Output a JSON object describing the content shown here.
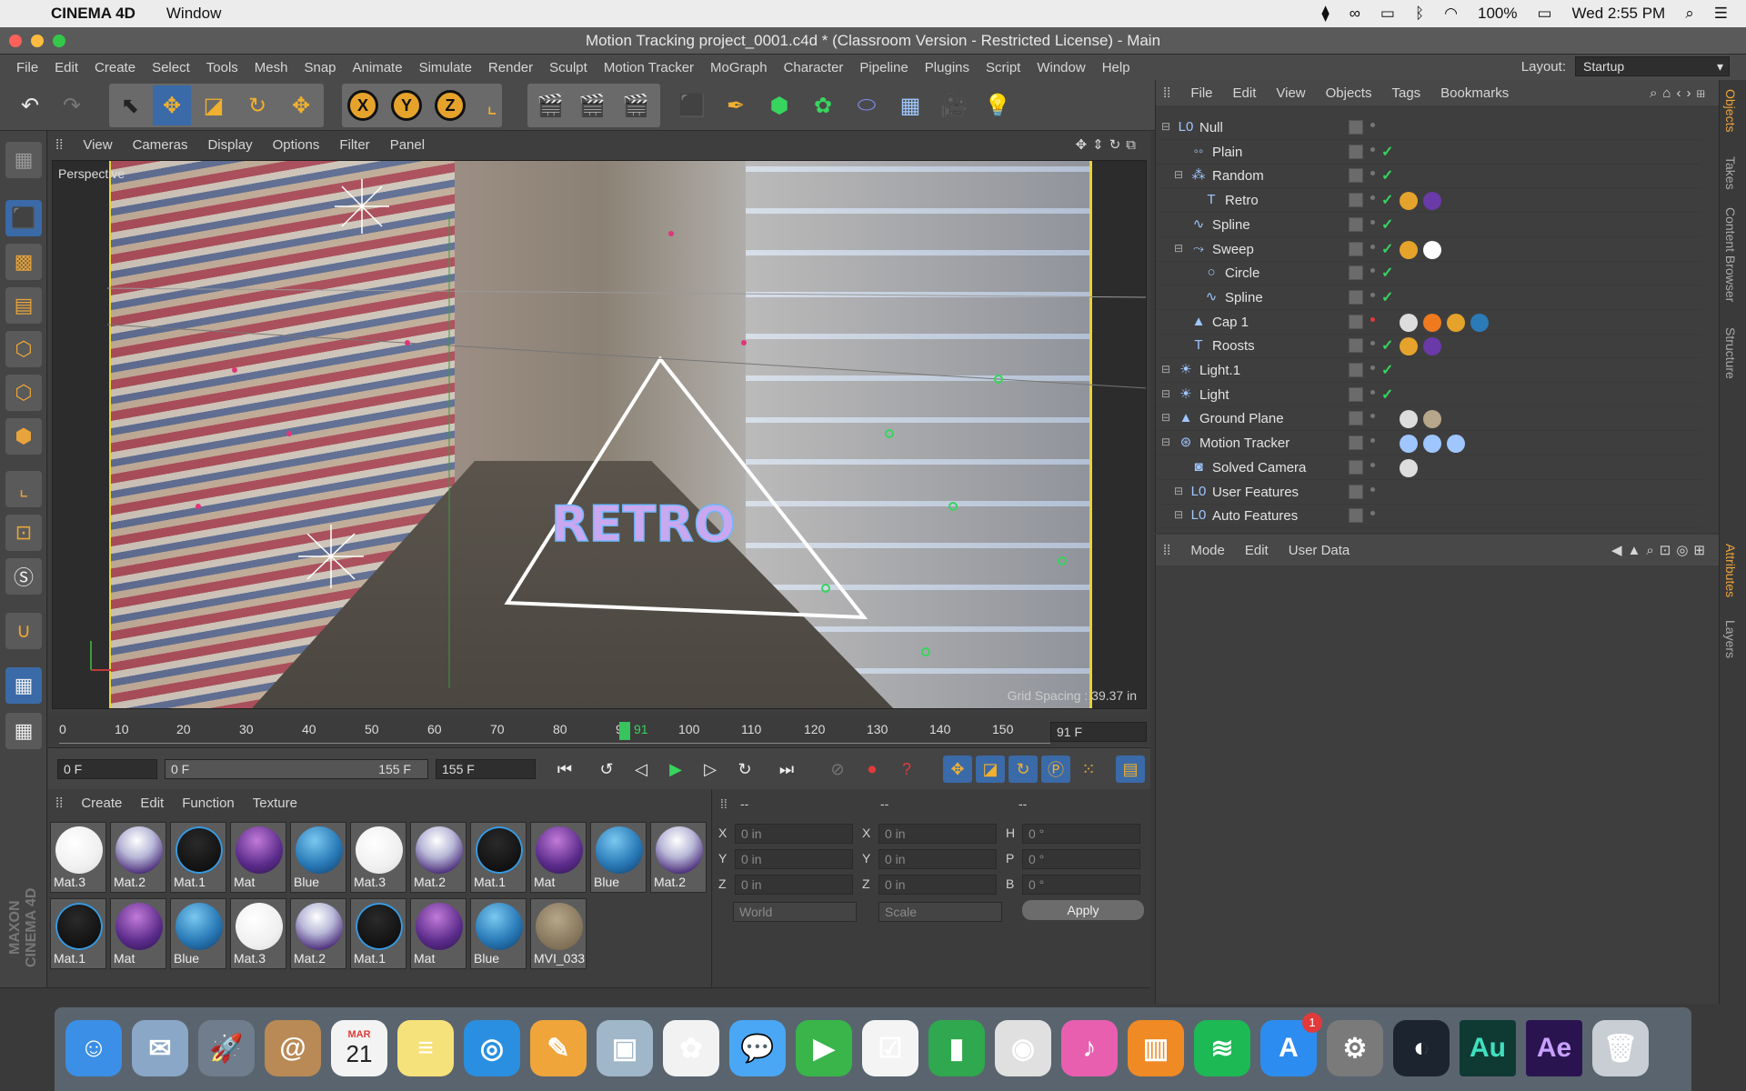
{
  "macmenubar": {
    "apple": "",
    "app_name": "CINEMA 4D",
    "menu_window": "Window",
    "battery": "100%",
    "clock": "Wed 2:55 PM"
  },
  "window_title": "Motion Tracking project_0001.c4d * (Classroom Version - Restricted License) - Main",
  "main_menu": [
    "File",
    "Edit",
    "Create",
    "Select",
    "Tools",
    "Mesh",
    "Snap",
    "Animate",
    "Simulate",
    "Render",
    "Sculpt",
    "Motion Tracker",
    "MoGraph",
    "Character",
    "Pipeline",
    "Plugins",
    "Script",
    "Window",
    "Help"
  ],
  "layout": {
    "label": "Layout:",
    "value": "Startup"
  },
  "viewport": {
    "menu": [
      "View",
      "Cameras",
      "Display",
      "Options",
      "Filter",
      "Panel"
    ],
    "label": "Perspective",
    "overlay_text": "RETRO",
    "grid_spacing": "Grid Spacing : 39.37 in"
  },
  "timeline": {
    "ticks": [
      "0",
      "10",
      "20",
      "30",
      "40",
      "50",
      "60",
      "70",
      "80",
      "90",
      "100",
      "110",
      "120",
      "130",
      "140",
      "150"
    ],
    "current_marker": "91",
    "current_field": "91 F",
    "start_field": "0 F",
    "range_start": "0 F",
    "range_end": "155 F",
    "end_field": "155 F"
  },
  "materials": {
    "menu": [
      "Create",
      "Edit",
      "Function",
      "Texture"
    ],
    "items": [
      {
        "name": "Mat.3",
        "type": "white"
      },
      {
        "name": "Mat.2",
        "type": "silver"
      },
      {
        "name": "Mat.1",
        "type": "black"
      },
      {
        "name": "Mat",
        "type": "purple"
      },
      {
        "name": "Blue",
        "type": "blue"
      },
      {
        "name": "Mat.3",
        "type": "white"
      },
      {
        "name": "Mat.2",
        "type": "silver"
      },
      {
        "name": "Mat.1",
        "type": "black"
      },
      {
        "name": "Mat",
        "type": "purple"
      },
      {
        "name": "Blue",
        "type": "blue"
      },
      {
        "name": "Mat.2",
        "type": "silver"
      },
      {
        "name": "Mat.1",
        "type": "black"
      },
      {
        "name": "Mat",
        "type": "purple"
      },
      {
        "name": "Blue",
        "type": "blue"
      },
      {
        "name": "Mat.3",
        "type": "white"
      },
      {
        "name": "Mat.2",
        "type": "silver"
      },
      {
        "name": "Mat.1",
        "type": "black"
      },
      {
        "name": "Mat",
        "type": "purple"
      },
      {
        "name": "Blue",
        "type": "blue"
      },
      {
        "name": "MVI_033",
        "type": "video"
      }
    ]
  },
  "coords": {
    "headers": [
      "--",
      "--",
      "--"
    ],
    "rows": [
      {
        "a": "X",
        "av": "0 in",
        "b": "X",
        "bv": "0 in",
        "c": "H",
        "cv": "0 °"
      },
      {
        "a": "Y",
        "av": "0 in",
        "b": "Y",
        "bv": "0 in",
        "c": "P",
        "cv": "0 °"
      },
      {
        "a": "Z",
        "av": "0 in",
        "b": "Z",
        "bv": "0 in",
        "c": "B",
        "cv": "0 °"
      }
    ],
    "mode1": "World",
    "mode2": "Scale",
    "apply": "Apply"
  },
  "object_manager": {
    "menu": [
      "File",
      "Edit",
      "View",
      "Objects",
      "Tags",
      "Bookmarks"
    ],
    "objects": [
      {
        "name": "Null",
        "indent": 0,
        "icon": "null-icon"
      },
      {
        "name": "Plain",
        "indent": 1,
        "icon": "plain-effector-icon"
      },
      {
        "name": "Random",
        "indent": 1,
        "icon": "random-effector-icon"
      },
      {
        "name": "Retro",
        "indent": 2,
        "icon": "text-icon"
      },
      {
        "name": "Spline",
        "indent": 1,
        "icon": "spline-icon"
      },
      {
        "name": "Sweep",
        "indent": 1,
        "icon": "sweep-icon"
      },
      {
        "name": "Circle",
        "indent": 2,
        "icon": "circle-icon"
      },
      {
        "name": "Spline",
        "indent": 2,
        "icon": "spline-icon"
      },
      {
        "name": "Cap 1",
        "indent": 1,
        "icon": "cap-icon"
      },
      {
        "name": "Roosts",
        "indent": 1,
        "icon": "text-icon"
      },
      {
        "name": "Light.1",
        "indent": 0,
        "icon": "light-icon"
      },
      {
        "name": "Light",
        "indent": 0,
        "icon": "light-icon"
      },
      {
        "name": "Ground Plane",
        "indent": 0,
        "icon": "plane-icon"
      },
      {
        "name": "Motion Tracker",
        "indent": 0,
        "icon": "motion-tracker-icon"
      },
      {
        "name": "Solved Camera",
        "indent": 1,
        "icon": "camera-icon"
      },
      {
        "name": "User Features",
        "indent": 1,
        "icon": "null-icon"
      },
      {
        "name": "Auto Features",
        "indent": 1,
        "icon": "null-icon"
      }
    ]
  },
  "attributes": {
    "menu": [
      "Mode",
      "Edit",
      "User Data"
    ]
  },
  "side_tabs": [
    "Objects",
    "Takes",
    "Content Browser",
    "Structure",
    "Attributes",
    "Layers"
  ],
  "brand": "MAXON CINEMA 4D",
  "dock": {
    "calendar_month": "MAR",
    "calendar_day": "21",
    "appstore_badge": "1",
    "apps": [
      {
        "name": "Finder",
        "color": "#3b8fe6"
      },
      {
        "name": "Mail",
        "color": "#8aa7c7"
      },
      {
        "name": "Launchpad",
        "color": "#6f7d8c"
      },
      {
        "name": "Contacts",
        "color": "#b98a55"
      },
      {
        "name": "Calendar",
        "color": "#f3f3f3"
      },
      {
        "name": "Notes",
        "color": "#f6e27a"
      },
      {
        "name": "Safari",
        "color": "#2a8fe0"
      },
      {
        "name": "Pages",
        "color": "#f0a53b"
      },
      {
        "name": "Preview",
        "color": "#9fb7c9"
      },
      {
        "name": "Photos",
        "color": "#f2f2f2"
      },
      {
        "name": "Messages",
        "color": "#4aa7f5"
      },
      {
        "name": "FaceTime",
        "color": "#39b54a"
      },
      {
        "name": "Reminders",
        "color": "#f4f4f4"
      },
      {
        "name": "Numbers",
        "color": "#2fa84f"
      },
      {
        "name": "Chrome",
        "color": "#e0e0e0"
      },
      {
        "name": "iTunes",
        "color": "#e85fb0"
      },
      {
        "name": "iBooks",
        "color": "#f08a24"
      },
      {
        "name": "Spotify",
        "color": "#1db954"
      },
      {
        "name": "App Store",
        "color": "#2d8cf0"
      },
      {
        "name": "System Preferences",
        "color": "#7a7a7a"
      },
      {
        "name": "Cinema 4D",
        "color": "#1c2430"
      },
      {
        "name": "Audition",
        "color": "#0e3a33"
      },
      {
        "name": "After Effects",
        "color": "#2a1450"
      },
      {
        "name": "Trash",
        "color": "#c8ced4"
      }
    ],
    "au_label": "Au",
    "ae_label": "Ae"
  },
  "colors": {
    "accent": "#3a6aa8",
    "check": "#37d45e",
    "timeline_marker": "#37c35d"
  }
}
